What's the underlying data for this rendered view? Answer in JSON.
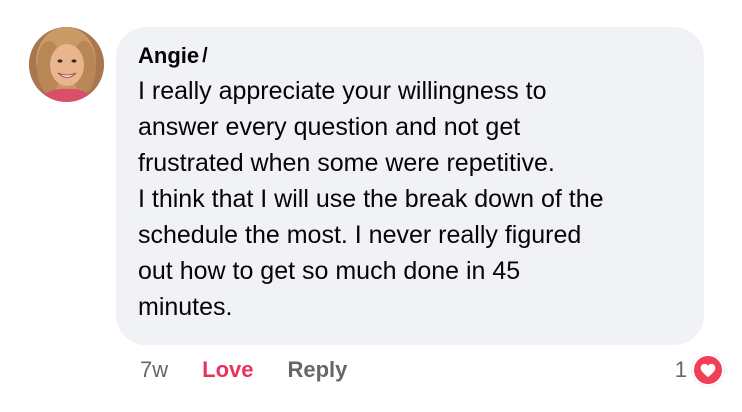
{
  "comment": {
    "author": "Angie",
    "author_truncated": "/",
    "text_lines": [
      "I really appreciate your willingness to",
      "answer every question and not get",
      "frustrated when some were repetitive.",
      "I think that I will use the break down of the",
      "schedule the most. I never really figured",
      "out how to get so much done in 45",
      "minutes."
    ]
  },
  "actions": {
    "time": "7w",
    "love_label": "Love",
    "reply_label": "Reply"
  },
  "reactions": {
    "count": "1",
    "icon": "heart-icon"
  },
  "colors": {
    "bubble_bg": "#f0f2f5",
    "love_color": "#e8335a",
    "secondary_text": "#65676b",
    "heart_badge": "#f33e58"
  }
}
